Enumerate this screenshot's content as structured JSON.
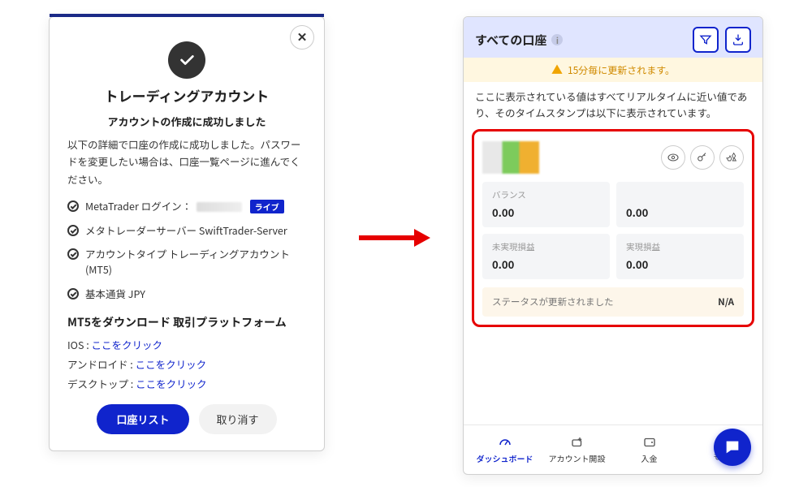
{
  "modal": {
    "title": "トレーディングアカウント",
    "subtitle": "アカウントの作成に成功しました",
    "description": "以下の詳細で口座の作成に成功しました。パスワードを変更したい場合は、口座一覧ページに進んでください。",
    "info": {
      "login_label": "MetaTrader ログイン：",
      "live_badge": "ライブ",
      "server": "メタトレーダーサーバー SwiftTrader-Server",
      "account_type": "アカウントタイプ トレーディングアカウント (MT5)",
      "base_currency": "基本通貨 JPY"
    },
    "download": {
      "heading": "MT5をダウンロード 取引プラットフォーム",
      "ios_label": "IOS : ",
      "android_label": "アンドロイド : ",
      "desktop_label": "デスクトップ : ",
      "link_text": "ここをクリック"
    },
    "buttons": {
      "primary": "口座リスト",
      "secondary": "取り消す"
    }
  },
  "app": {
    "header_title": "すべての口座",
    "notice": "15分毎に更新されます。",
    "subtext": "ここに表示されている値はすべてリアルタイムに近い値であり、そのタイムスタンプは以下に表示されています。",
    "stats": {
      "balance_label": "バランス",
      "balance_value": "0.00",
      "right1_value": "0.00",
      "unrealized_label": "未実現損益",
      "unrealized_value": "0.00",
      "realized_label": "実現損益",
      "realized_value": "0.00"
    },
    "status": {
      "label": "ステータスが更新されました",
      "value": "N/A"
    },
    "footer": {
      "dashboard": "ダッシュボード",
      "open_account": "アカウント開設",
      "deposit": "入金",
      "more": "もっ"
    }
  }
}
